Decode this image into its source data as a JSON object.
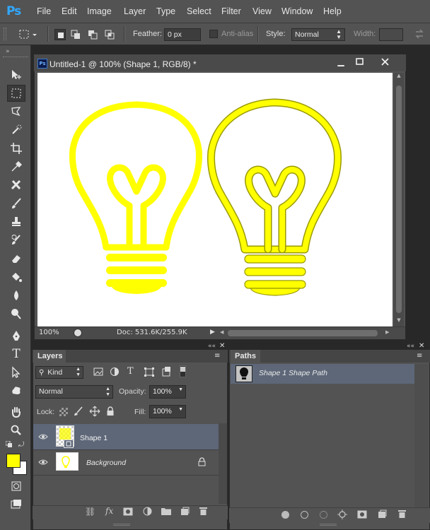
{
  "app": {
    "logo": "Ps"
  },
  "menu": [
    "File",
    "Edit",
    "Image",
    "Layer",
    "Type",
    "Select",
    "Filter",
    "View",
    "Window",
    "Help"
  ],
  "options": {
    "feather_label": "Feather:",
    "feather_value": "0 px",
    "antialias_label": "Anti-alias",
    "style_label": "Style:",
    "style_value": "Normal",
    "width_label": "Width:"
  },
  "document": {
    "title": "Untitled-1 @ 100% (Shape 1, RGB/8) *",
    "zoom": "100%",
    "doc_info": "Doc: 531.6K/255.9K",
    "bulb_color": "#ffff00",
    "outline_color": "#b8b800"
  },
  "layers_panel": {
    "tab": "Layers",
    "kind_label": "Kind",
    "blend_mode": "Normal",
    "opacity_label": "Opacity:",
    "opacity_value": "100%",
    "lock_label": "Lock:",
    "fill_label": "Fill:",
    "fill_value": "100%",
    "layers": [
      {
        "name": "Shape 1",
        "selected": true
      },
      {
        "name": "Background",
        "selected": false,
        "locked": true
      }
    ]
  },
  "paths_panel": {
    "tab": "Paths",
    "items": [
      {
        "name": "Shape 1 Shape Path"
      }
    ]
  },
  "colors": {
    "foreground": "#ffff00",
    "background": "#ffffff",
    "selected_row": "#5d6778",
    "panel_bg": "#535353"
  }
}
